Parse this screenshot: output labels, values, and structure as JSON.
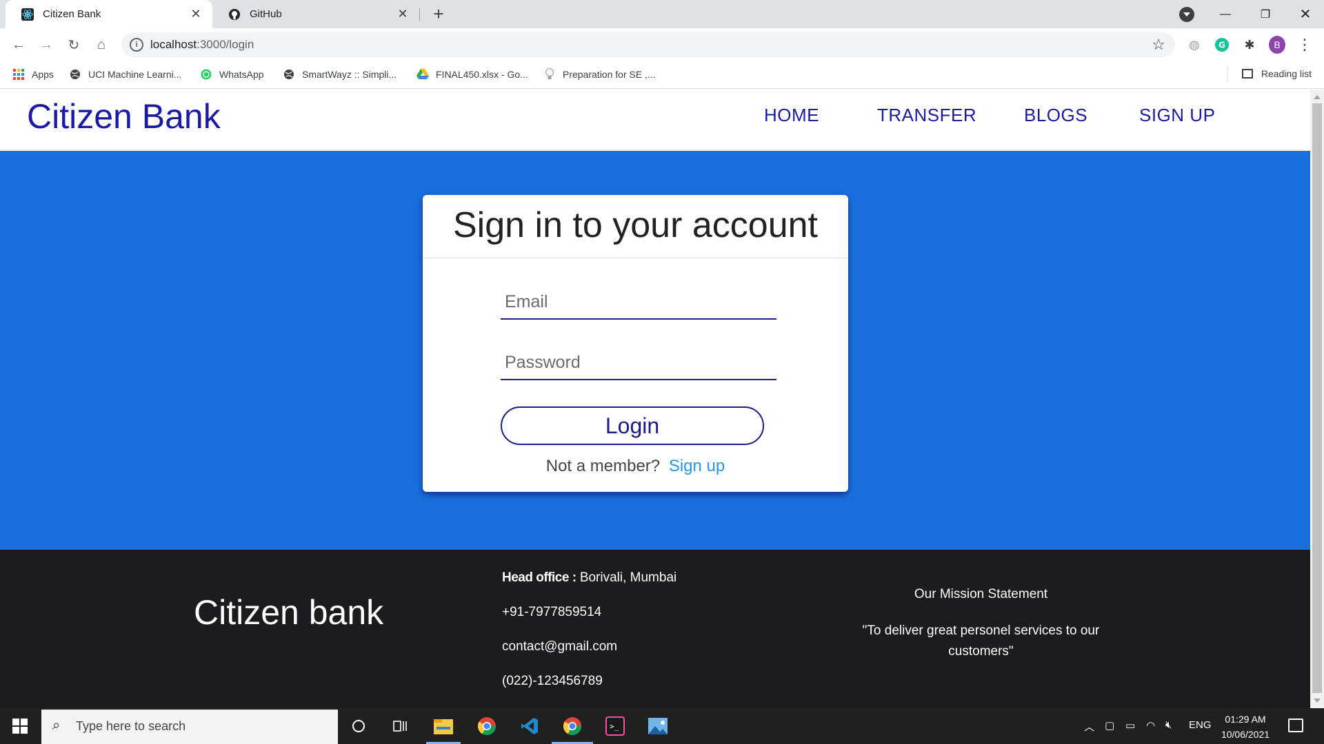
{
  "browser": {
    "tabs": [
      {
        "title": "Citizen Bank",
        "icon": "react-icon"
      },
      {
        "title": "GitHub",
        "icon": "github-icon"
      }
    ],
    "url_host": "localhost",
    "url_path": ":3000/login",
    "profile_initial": "B"
  },
  "bookmarks": {
    "items": [
      {
        "label": "Apps",
        "icon": "apps-grid-icon"
      },
      {
        "label": "UCI Machine Learni...",
        "icon": "globe-icon"
      },
      {
        "label": "WhatsApp",
        "icon": "whatsapp-icon"
      },
      {
        "label": "SmartWayz :: Simpli...",
        "icon": "globe-icon"
      },
      {
        "label": "FINAL450.xlsx - Go...",
        "icon": "google-drive-icon"
      },
      {
        "label": "Preparation for SE ,...",
        "icon": "lightbulb-icon"
      }
    ],
    "reading_list": "Reading list"
  },
  "site": {
    "brand": "Citizen Bank",
    "nav": [
      "HOME",
      "TRANSFER",
      "BLOGS",
      "SIGN UP"
    ],
    "colors": {
      "primary": "#1a6fdf",
      "navy": "#1a1aa6",
      "link": "#2196f3",
      "footer": "#1c1c1e"
    }
  },
  "login": {
    "title": "Sign in to your account",
    "email_placeholder": "Email",
    "password_placeholder": "Password",
    "button": "Login",
    "member_prompt": "Not a member?",
    "signup_link": "Sign up"
  },
  "footer": {
    "brand": "Citizen bank",
    "head_office_label": "Head office :",
    "head_office_value": "Borivali, Mumbai",
    "phone": "+91-7977859514",
    "email": "contact@gmail.com",
    "landline": "(022)-123456789",
    "mission_title": "Our Mission Statement",
    "mission_text": "\"To deliver great personel services to our customers\""
  },
  "taskbar": {
    "search_placeholder": "Type here to search",
    "lang": "ENG",
    "time": "01:29 AM",
    "date": "10/06/2021"
  }
}
